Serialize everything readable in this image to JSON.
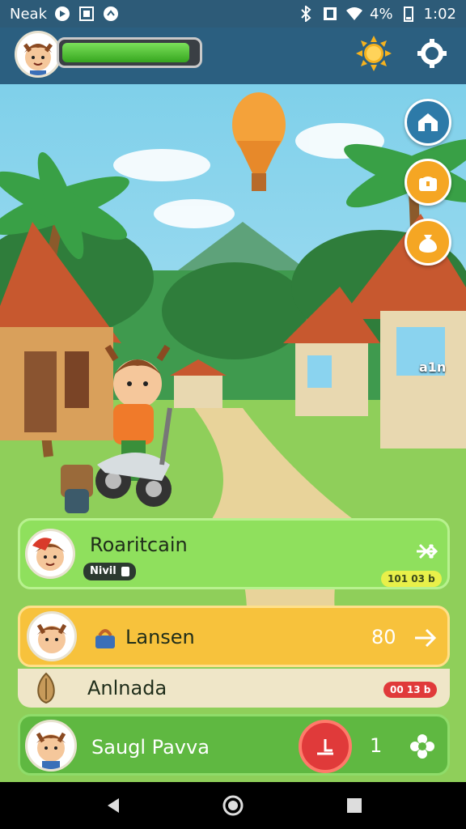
{
  "status_bar": {
    "carrier": "Neak",
    "battery": "4%",
    "time": "1:02",
    "icons": [
      "media-icon",
      "image-icon",
      "notification-icon",
      "bluetooth-icon",
      "vibrate-icon",
      "wifi-icon",
      "battery-icon"
    ]
  },
  "top_bar": {
    "progress": 0.95,
    "icons": [
      "player-avatar",
      "sun-icon",
      "settings-gear-icon"
    ]
  },
  "side_buttons": {
    "coin_label": "a1n",
    "icons": [
      "house-icon",
      "chest-icon",
      "coin-bag-icon"
    ]
  },
  "cards": [
    {
      "title": "Roaritcain",
      "tag": "Nivil",
      "tag_icon": "lock-icon",
      "badge": "101 03 b",
      "action_icon": "close-icon",
      "color": "#8fe05d"
    },
    {
      "title": "Lansen",
      "count": "80",
      "icon": "basket-icon",
      "action_icon": "arrow-right-icon",
      "color": "#f7c23c"
    },
    {
      "title": "Anlnada",
      "badge": "00 13 b",
      "icon": "seed-icon",
      "color": "#efe6c8"
    },
    {
      "title": "Saugl Pavva",
      "count": "1",
      "action_icon": "timer-icon",
      "extra_icon": "flower-gear-icon",
      "color": "#5fb841"
    }
  ],
  "nav_bar": {
    "icons": [
      "back-icon",
      "home-icon",
      "recents-icon"
    ]
  },
  "colors": {
    "status_bar": "#2d5b78",
    "green_card": "#8fe05d",
    "yellow_card": "#f7c23c",
    "bottom_card": "#5fb841",
    "red_button": "#e03a3a"
  }
}
